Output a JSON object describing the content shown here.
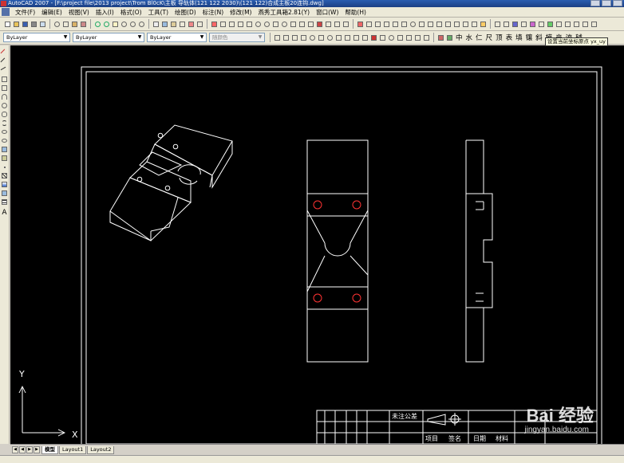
{
  "window": {
    "title": "AutoCAD 2007 - [F:\\project file\\2013 project\\Trom Bl0cK\\主板 导轨体(121 122 2030)\\(121 122)合成主板20连钩.dwg]"
  },
  "menubar": {
    "items": [
      "文件(F)",
      "编辑(E)",
      "视图(V)",
      "插入(I)",
      "格式(O)",
      "工具(T)",
      "绘图(D)",
      "标注(N)",
      "修改(M)",
      "燕秀工具箱2.81(Y)",
      "窗口(W)",
      "帮助(H)"
    ]
  },
  "properties_toolbar": {
    "layer": "ByLayer",
    "linetype": "ByLayer",
    "lineweight": "ByLayer",
    "plotstyle": "随颜色"
  },
  "plugin_toolbar": {
    "chars": [
      "中",
      "水",
      "仁",
      "尺",
      "顶",
      "表",
      "填",
      "镶",
      "斜",
      "模",
      "产",
      "流",
      "辅"
    ]
  },
  "tooltip": {
    "text": "设置当前坐标原点 yx_uy"
  },
  "left_toolbar": {
    "text_tool": "A"
  },
  "layout_tabs": [
    "模型",
    "Layout1",
    "Layout2"
  ],
  "title_block": {
    "header": "未注公差",
    "row_labels": [
      "项目",
      "签名",
      "日期",
      "材料"
    ]
  },
  "ucs": {
    "x_label": "X",
    "y_label": "Y"
  },
  "watermark": {
    "brand": "Bai 经验",
    "url": "jingyan.baidu.com"
  },
  "colors": {
    "canvas": "#000000",
    "lines": "#ffffff",
    "holes": "#ff3333",
    "toolbar": "#ece9d8",
    "titlebar": "#1f4a9c"
  }
}
